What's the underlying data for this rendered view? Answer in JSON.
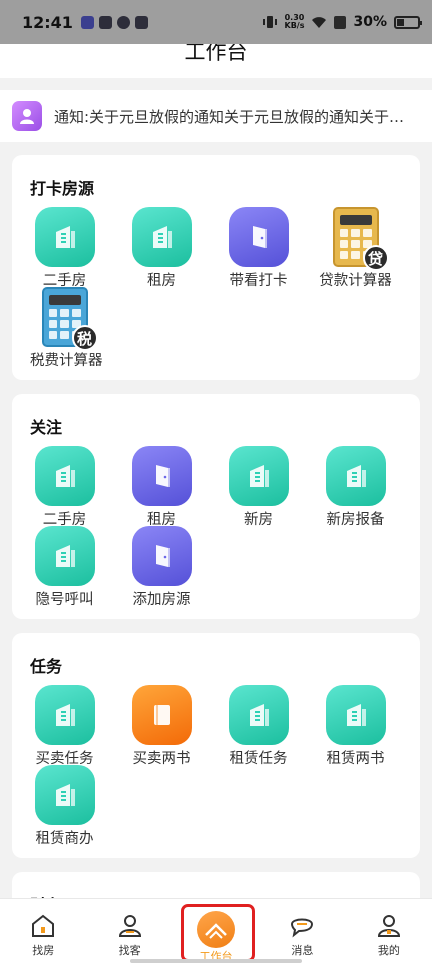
{
  "status_bar": {
    "time": "12:41",
    "speed_top": "0.30",
    "speed_bottom": "KB/s",
    "battery": "30%"
  },
  "header": {
    "title": "工作台"
  },
  "notice": {
    "text": "通知:关于元旦放假的通知关于元旦放假的通知关于…"
  },
  "sections": [
    {
      "title": "打卡房源",
      "items": [
        {
          "label": "二手房",
          "icon": "building-icon",
          "color": "teal"
        },
        {
          "label": "租房",
          "icon": "building-icon",
          "color": "teal"
        },
        {
          "label": "带看打卡",
          "icon": "door-icon",
          "color": "purple"
        },
        {
          "label": "贷款计算器",
          "icon": "loan-calculator-icon",
          "badge": "贷"
        },
        {
          "label": "税费计算器",
          "icon": "tax-calculator-icon",
          "badge": "税"
        }
      ]
    },
    {
      "title": "关注",
      "items": [
        {
          "label": "二手房",
          "icon": "building-icon",
          "color": "teal"
        },
        {
          "label": "租房",
          "icon": "door-icon",
          "color": "purple"
        },
        {
          "label": "新房",
          "icon": "building-icon",
          "color": "teal"
        },
        {
          "label": "新房报备",
          "icon": "building-icon",
          "color": "teal"
        },
        {
          "label": "隐号呼叫",
          "icon": "building-icon",
          "color": "teal"
        },
        {
          "label": "添加房源",
          "icon": "door-icon",
          "color": "purple"
        }
      ]
    },
    {
      "title": "任务",
      "items": [
        {
          "label": "买卖任务",
          "icon": "building-icon",
          "color": "teal"
        },
        {
          "label": "买卖两书",
          "icon": "book-icon",
          "color": "orange"
        },
        {
          "label": "租赁任务",
          "icon": "building-icon",
          "color": "teal"
        },
        {
          "label": "租赁两书",
          "icon": "building-icon",
          "color": "teal"
        },
        {
          "label": "租赁商办",
          "icon": "building-icon",
          "color": "teal"
        }
      ]
    },
    {
      "title": "财务"
    }
  ],
  "tabbar": [
    {
      "label": "找房",
      "icon": "home-icon"
    },
    {
      "label": "找客",
      "icon": "person-icon"
    },
    {
      "label": "工作台",
      "icon": "workbench-icon",
      "active": true
    },
    {
      "label": "消息",
      "icon": "message-icon"
    },
    {
      "label": "我的",
      "icon": "profile-icon"
    }
  ],
  "colors": {
    "teal": "#2fd1b5",
    "purple": "#6b67e8",
    "orange": "#f7841a",
    "active_tab": "#f39a1c",
    "highlight": "#e02020"
  }
}
